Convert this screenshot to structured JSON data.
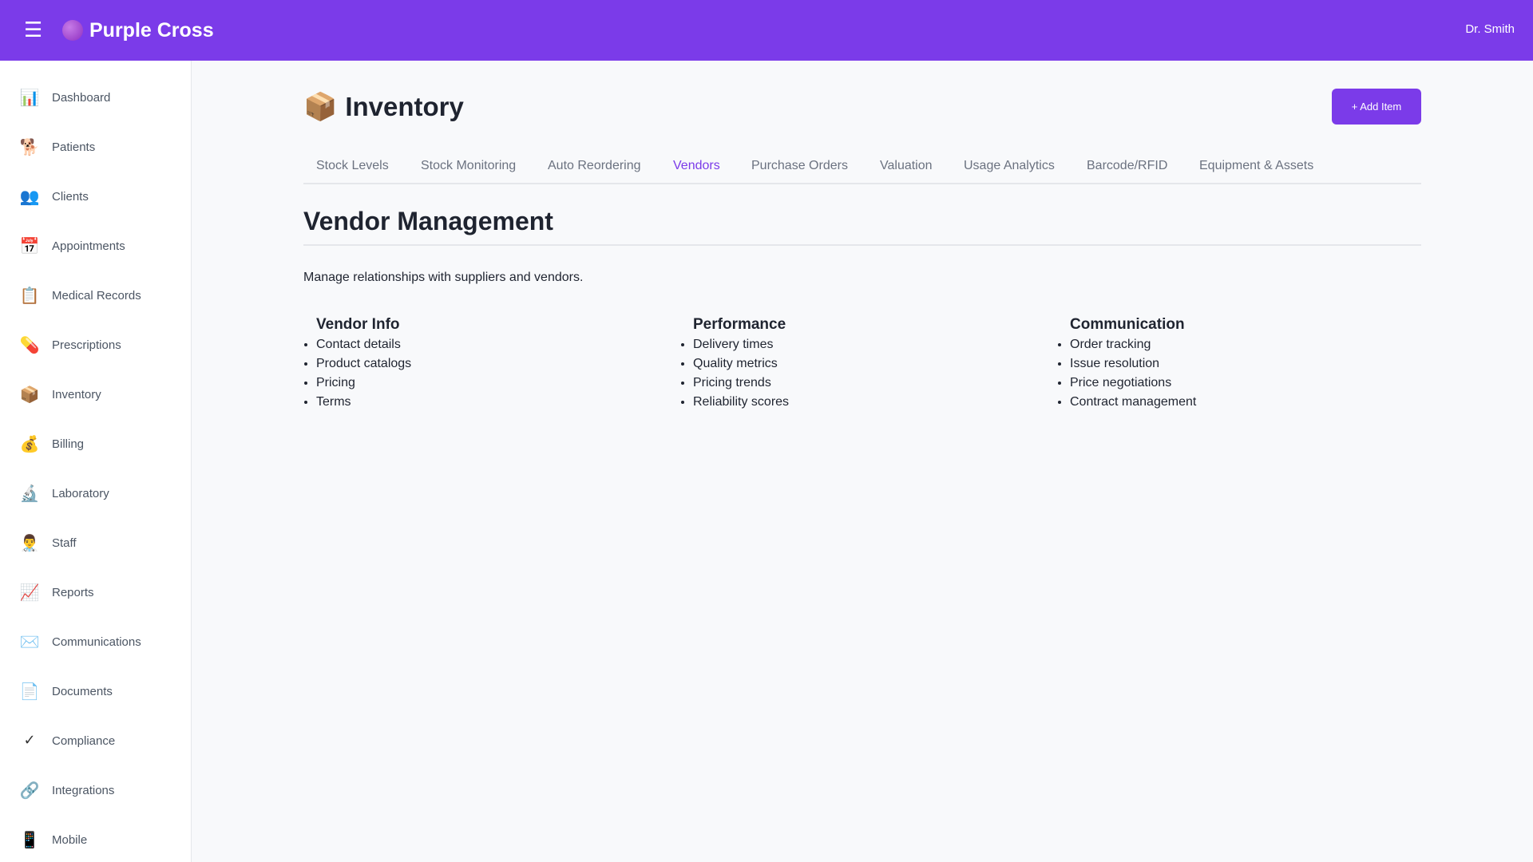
{
  "header": {
    "menu_icon": "hamburger-icon",
    "brand_icon": "purple-circle-icon",
    "brand_name": "Purple Cross",
    "user_name": "Dr. Smith",
    "brand_color": "#7b3be9"
  },
  "sidebar": {
    "items": [
      {
        "label": "Dashboard",
        "icon": "bar-chart-icon",
        "glyph": "📊"
      },
      {
        "label": "Patients",
        "icon": "dog-icon",
        "glyph": "🐕"
      },
      {
        "label": "Clients",
        "icon": "people-icon",
        "glyph": "👥"
      },
      {
        "label": "Appointments",
        "icon": "calendar-icon",
        "glyph": "📅"
      },
      {
        "label": "Medical Records",
        "icon": "clipboard-icon",
        "glyph": "📋"
      },
      {
        "label": "Prescriptions",
        "icon": "pill-icon",
        "glyph": "💊"
      },
      {
        "label": "Inventory",
        "icon": "package-icon",
        "glyph": "📦"
      },
      {
        "label": "Billing",
        "icon": "money-bag-icon",
        "glyph": "💰"
      },
      {
        "label": "Laboratory",
        "icon": "microscope-icon",
        "glyph": "🔬"
      },
      {
        "label": "Staff",
        "icon": "doctor-icon",
        "glyph": "👨‍⚕️"
      },
      {
        "label": "Reports",
        "icon": "trend-chart-icon",
        "glyph": "📈"
      },
      {
        "label": "Communications",
        "icon": "envelope-icon",
        "glyph": "✉️"
      },
      {
        "label": "Documents",
        "icon": "document-icon",
        "glyph": "📄"
      },
      {
        "label": "Compliance",
        "icon": "check-icon",
        "glyph": "✓"
      },
      {
        "label": "Integrations",
        "icon": "link-icon",
        "glyph": "🔗"
      },
      {
        "label": "Mobile",
        "icon": "mobile-phone-icon",
        "glyph": "📱"
      }
    ]
  },
  "page": {
    "icon": "package-icon",
    "icon_glyph": "📦",
    "title": "Inventory",
    "add_button": "+ Add Item"
  },
  "tabs": [
    {
      "label": "Stock Levels",
      "active": false
    },
    {
      "label": "Stock Monitoring",
      "active": false
    },
    {
      "label": "Auto Reordering",
      "active": false
    },
    {
      "label": "Vendors",
      "active": true
    },
    {
      "label": "Purchase Orders",
      "active": false
    },
    {
      "label": "Valuation",
      "active": false
    },
    {
      "label": "Usage Analytics",
      "active": false
    },
    {
      "label": "Barcode/RFID",
      "active": false
    },
    {
      "label": "Equipment & Assets",
      "active": false
    }
  ],
  "section": {
    "title": "Vendor Management",
    "description": "Manage relationships with suppliers and vendors.",
    "columns": [
      {
        "heading": "Vendor Info",
        "items": [
          "Contact details",
          "Product catalogs",
          "Pricing",
          "Terms"
        ]
      },
      {
        "heading": "Performance",
        "items": [
          "Delivery times",
          "Quality metrics",
          "Pricing trends",
          "Reliability scores"
        ]
      },
      {
        "heading": "Communication",
        "items": [
          "Order tracking",
          "Issue resolution",
          "Price negotiations",
          "Contract management"
        ]
      }
    ]
  }
}
